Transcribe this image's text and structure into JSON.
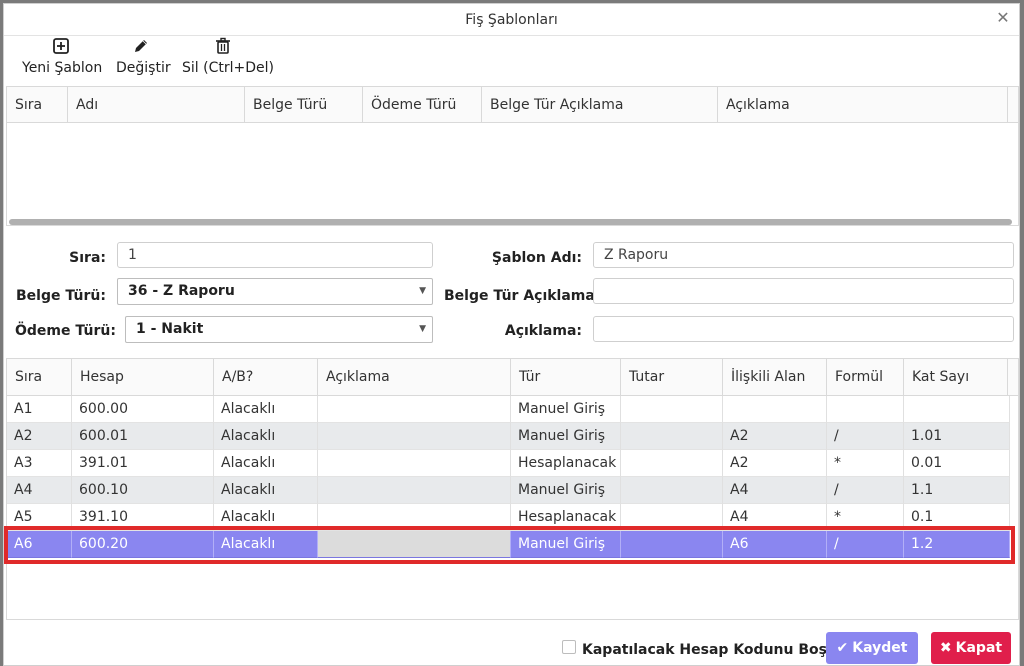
{
  "dialog": {
    "title": "Fiş Şablonları"
  },
  "toolbar": {
    "new_label": "Yeni Şablon",
    "edit_label": "Değiştir",
    "delete_label": "Sil (Ctrl+Del)"
  },
  "templates_grid": {
    "columns": [
      "Sıra",
      "Adı",
      "Belge Türü",
      "Ödeme Türü",
      "Belge Tür Açıklama",
      "Açıklama"
    ]
  },
  "form": {
    "sira_label": "Sıra:",
    "sira_value": "1",
    "sablon_adi_label": "Şablon Adı:",
    "sablon_adi_value": "Z Raporu",
    "belge_turu_label": "Belge Türü:",
    "belge_turu_value": "36 - Z Raporu",
    "belge_tur_aciklama_label": "Belge Tür Açıklama:",
    "belge_tur_aciklama_value": "",
    "odeme_turu_label": "Ödeme Türü:",
    "odeme_turu_value": "1 - Nakit",
    "aciklama_label": "Açıklama:",
    "aciklama_value": ""
  },
  "lines_grid": {
    "columns": [
      "Sıra",
      "Hesap",
      "A/B?",
      "Açıklama",
      "Tür",
      "Tutar",
      "İlişkili Alan",
      "Formül",
      "Kat Sayı"
    ],
    "rows": [
      {
        "sira": "A1",
        "hesap": "600.00",
        "ab": "Alacaklı",
        "aciklama": "",
        "tur": "Manuel Giriş",
        "tutar": "",
        "iliskili": "",
        "formul": "",
        "kat": ""
      },
      {
        "sira": "A2",
        "hesap": "600.01",
        "ab": "Alacaklı",
        "aciklama": "",
        "tur": "Manuel Giriş",
        "tutar": "",
        "iliskili": "A2",
        "formul": "/",
        "kat": "1.01"
      },
      {
        "sira": "A3",
        "hesap": "391.01",
        "ab": "Alacaklı",
        "aciklama": "",
        "tur": "Hesaplanacak",
        "tutar": "",
        "iliskili": "A2",
        "formul": "*",
        "kat": "0.01"
      },
      {
        "sira": "A4",
        "hesap": "600.10",
        "ab": "Alacaklı",
        "aciklama": "",
        "tur": "Manuel Giriş",
        "tutar": "",
        "iliskili": "A4",
        "formul": "/",
        "kat": "1.1"
      },
      {
        "sira": "A5",
        "hesap": "391.10",
        "ab": "Alacaklı",
        "aciklama": "",
        "tur": "Hesaplanacak",
        "tutar": "",
        "iliskili": "A4",
        "formul": "*",
        "kat": "0.1"
      },
      {
        "sira": "A6",
        "hesap": "600.20",
        "ab": "Alacaklı",
        "aciklama": "",
        "tur": "Manuel Giriş",
        "tutar": "",
        "iliskili": "A6",
        "formul": "/",
        "kat": "1.2"
      }
    ]
  },
  "footer": {
    "checkbox_label": "Kapatılacak Hesap Kodunu Boşalt",
    "save_label": "Kaydet",
    "close_label": "Kapat"
  },
  "colors": {
    "accent": "#8a86f0",
    "danger": "#e01f4b",
    "highlight": "#e02a2a"
  }
}
